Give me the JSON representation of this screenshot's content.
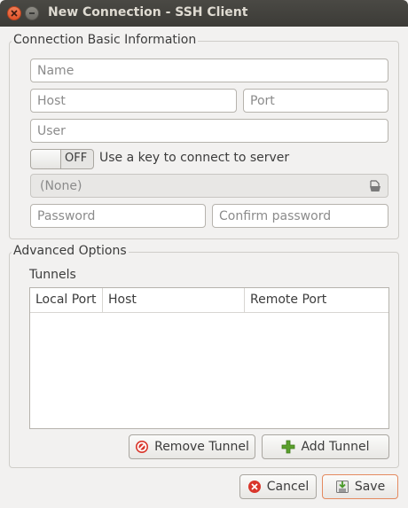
{
  "window": {
    "title": "New Connection - SSH Client"
  },
  "basic": {
    "frame_label": "Connection Basic Information",
    "name_placeholder": "Name",
    "host_placeholder": "Host",
    "port_placeholder": "Port",
    "user_placeholder": "User",
    "key_switch_state": "OFF",
    "key_switch_label": "Use a key to connect to server",
    "key_file_value": "(None)",
    "password_placeholder": "Password",
    "confirm_password_placeholder": "Confirm password"
  },
  "advanced": {
    "frame_label": "Advanced Options",
    "tunnels_label": "Tunnels",
    "columns": [
      "Local Port",
      "Host",
      "Remote Port"
    ],
    "rows": [],
    "remove_tunnel_label": "Remove Tunnel",
    "add_tunnel_label": "Add Tunnel"
  },
  "footer": {
    "cancel_label": "Cancel",
    "save_label": "Save"
  },
  "icons": {
    "close": "close-icon",
    "minimize": "minimize-icon",
    "file": "file-open-icon",
    "remove": "no-entry-icon",
    "add": "plus-icon",
    "cancel": "cancel-icon",
    "save": "save-icon"
  },
  "colors": {
    "titlebar": "#3c3b37",
    "close_button": "#e1542a",
    "default_button_border": "#e48a5f",
    "add_icon": "#5aa02c",
    "remove_icon": "#d9362b"
  }
}
